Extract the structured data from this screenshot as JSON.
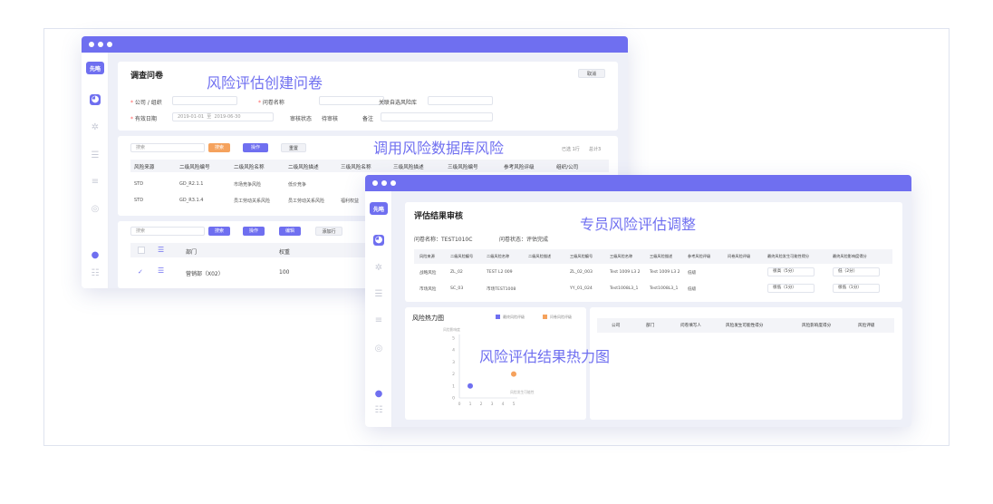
{
  "captions": {
    "c1": "风险评估创建问卷",
    "c2": "调用风险数据库风险",
    "c3": "专员风险评估调整",
    "c4": "风险评估结果热力图"
  },
  "app": {
    "logo": "先略"
  },
  "win1": {
    "title": "调查问卷",
    "cancel": "取消",
    "form": {
      "company_label": "公司 / 组织",
      "questionnaire_label": "问卷名称",
      "link_label": "关联自选风险库",
      "date_label": "有效日期",
      "date_start": "2019-01-01",
      "date_sep": "至",
      "date_end": "2019-06-30",
      "review_label": "审核状态",
      "review_value": "待审核",
      "remark_label": "备注"
    },
    "search": {
      "placeholder": "搜索",
      "search_btn": "搜索",
      "op_btn": "操作",
      "reset_btn": "重置",
      "selected": "已选 1行",
      "total": "总计3"
    },
    "table": {
      "headers": [
        "风险来源",
        "二级风险编号",
        "二级风险名称",
        "二级风险描述",
        "三级风险名称",
        "三级风险描述",
        "三级风险编号",
        "参考风险评级",
        "组织/公司"
      ],
      "rows": [
        [
          "STD",
          "GD_R2.1.1",
          "市场竞争风险",
          "低价竞争"
        ],
        [
          "STD",
          "GD_R3.1.4",
          "员工劳动关系风险",
          "员工劳动关系风险",
          "福利权益"
        ]
      ]
    },
    "dept": {
      "placeholder": "搜索",
      "search_btn": "搜索",
      "op_btn": "操作",
      "edit_btn": "编辑",
      "add_btn": "添加行",
      "headers": [
        "部门",
        "权重"
      ],
      "rows": [
        [
          "营销部（X02）",
          "100"
        ]
      ]
    }
  },
  "win2": {
    "title": "评估结果审核",
    "meta_name_label": "问卷名称：",
    "meta_name": "TEST1010C",
    "meta_status_label": "问卷状态：",
    "meta_status": "评估完成",
    "table": {
      "headers": [
        "风险来源",
        "二级风险编号",
        "二级风险名称",
        "二级风险描述",
        "三级风险编号",
        "三级风险名称",
        "三级风险描述",
        "参考风险评级",
        "问卷风险评级",
        "最终风险发生可能性得分",
        "最终风险影响度得分"
      ],
      "rows": [
        [
          "战略风险",
          "ZL_02",
          "TEST L2 009",
          "",
          "ZL_02_003",
          "Test 1009 L3 2",
          "Test 1009 L3 2",
          "低级",
          "",
          "很高（5分）",
          "低（2分）"
        ],
        [
          "市场风险",
          "SC_03",
          "市场TEST1008",
          "",
          "YY_01_024",
          "Test1008L3_1",
          "Test1008L3_1",
          "低级",
          "",
          "很低（1分）",
          "很低（1分）"
        ]
      ]
    },
    "heatmap": {
      "title": "风险热力图",
      "legend_a": "最终风险评级",
      "legend_b": "问卷风险评级",
      "y_title": "风险影响度",
      "x_title": "风险发生可能性",
      "color_a": "#6f6ff0",
      "color_b": "#f5a25d"
    },
    "right_table": {
      "headers": [
        "公司",
        "部门",
        "问卷填写人",
        "风险发生可能性得分",
        "风险影响度得分",
        "风险评级"
      ]
    }
  },
  "chart_data": {
    "type": "scatter",
    "x_ticks": [
      "0",
      "1",
      "2",
      "3",
      "4",
      "5"
    ],
    "y_ticks": [
      "0",
      "1",
      "2",
      "3",
      "4",
      "5"
    ],
    "xlim": [
      0,
      5
    ],
    "ylim": [
      0,
      5
    ],
    "series": [
      {
        "name": "最终风险评级",
        "color": "#6f6ff0",
        "points": [
          [
            1,
            1
          ]
        ]
      },
      {
        "name": "问卷风险评级",
        "color": "#f5a25d",
        "points": [
          [
            5,
            2
          ]
        ]
      }
    ]
  }
}
